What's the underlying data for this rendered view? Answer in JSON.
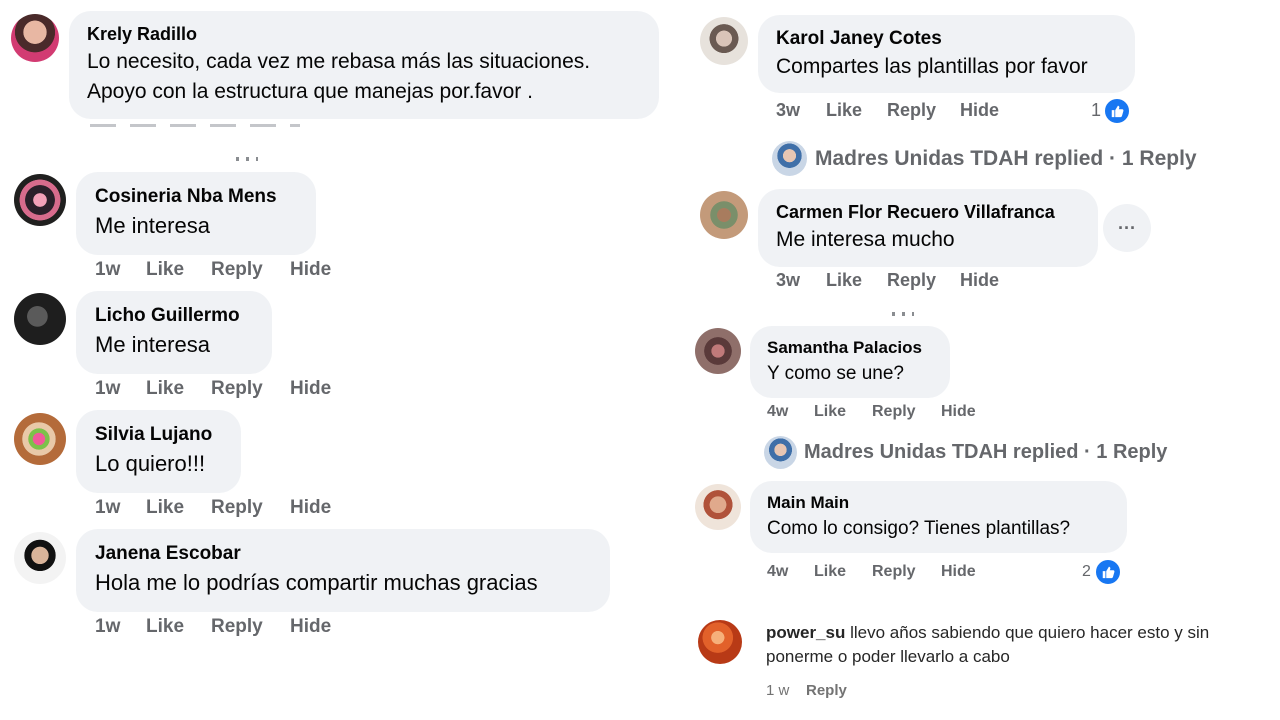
{
  "colors": {
    "bubble": "#f0f2f5",
    "meta": "#65676b",
    "name": "#050505",
    "like_blue": "#1877f2"
  },
  "left": {
    "comments": [
      {
        "name": "Krely Radillo",
        "lines": [
          "Lo necesito, cada vez me rebasa más las situaciones.",
          "Apoyo con la estructura que manejas por.favor ."
        ]
      },
      {
        "name": "Cosineria Nba Mens",
        "text": "Me interesa",
        "time": "1w",
        "like": "Like",
        "reply": "Reply",
        "hide": "Hide"
      },
      {
        "name": "Licho Guillermo",
        "text": "Me interesa",
        "time": "1w",
        "like": "Like",
        "reply": "Reply",
        "hide": "Hide"
      },
      {
        "name": "Silvia Lujano",
        "text": "Lo quiero!!!",
        "time": "1w",
        "like": "Like",
        "reply": "Reply",
        "hide": "Hide"
      },
      {
        "name": "Janena Escobar",
        "text": "Hola me lo podrías compartir muchas gracias",
        "time": "1w",
        "like": "Like",
        "reply": "Reply",
        "hide": "Hide"
      }
    ]
  },
  "right": {
    "comments": [
      {
        "name": "Karol Janey Cotes",
        "text": "Compartes las plantillas por favor",
        "time": "3w",
        "like": "Like",
        "reply": "Reply",
        "hide": "Hide",
        "likes": "1",
        "thread": "Madres Unidas TDAH replied · 1 Reply"
      },
      {
        "name": "Carmen Flor Recuero Villafranca",
        "text": "Me interesa mucho",
        "time": "3w",
        "like": "Like",
        "reply": "Reply",
        "hide": "Hide",
        "more": "···"
      },
      {
        "name": "Samantha Palacios",
        "text": "Y como se une?",
        "time": "4w",
        "like": "Like",
        "reply": "Reply",
        "hide": "Hide",
        "thread": "Madres Unidas TDAH replied · 1 Reply"
      },
      {
        "name": "Main Main",
        "text": "Como lo consigo? Tienes plantillas?",
        "time": "4w",
        "like": "Like",
        "reply": "Reply",
        "hide": "Hide",
        "likes": "2"
      },
      {
        "name": "power_su",
        "text": "llevo años sabiendo que quiero hacer esto y sin",
        "text2": "ponerme o poder llevarlo a cabo",
        "time": "1 w",
        "reply": "Reply"
      }
    ]
  }
}
